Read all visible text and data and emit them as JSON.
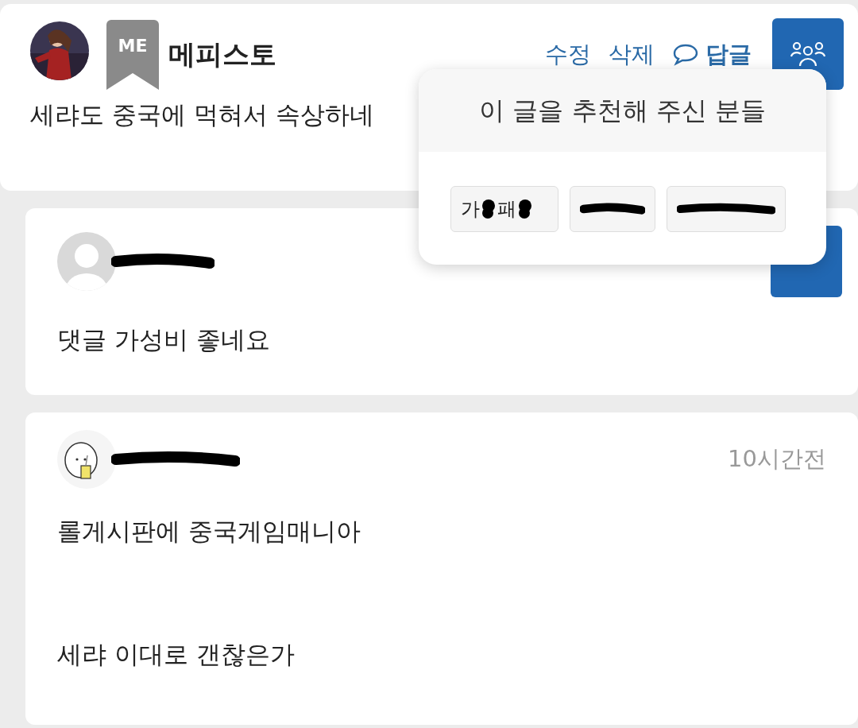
{
  "post": {
    "badge": "ME",
    "author": "메피스토",
    "actions": [
      {
        "kind": "link",
        "label": "수정"
      },
      {
        "kind": "link",
        "label": "삭제"
      },
      {
        "kind": "reply",
        "label": "답글"
      }
    ],
    "body": "세랴도 중국에 먹혀서 속상하네"
  },
  "popup": {
    "title": "이 글을 추천해 주신 분들",
    "chips": [
      {
        "kind": "partial",
        "parts": [
          "가",
          "패"
        ]
      },
      {
        "kind": "redacted"
      },
      {
        "kind": "redacted"
      }
    ]
  },
  "comments": [
    {
      "kind": "default-avatar",
      "lines": [
        "댓글 가성비 좋네요"
      ]
    },
    {
      "kind": "picture-avatar",
      "time": "10시간전",
      "lines": [
        "롤게시판에 중국게임매니아",
        "세랴 이대로 갠찮은가"
      ]
    }
  ]
}
